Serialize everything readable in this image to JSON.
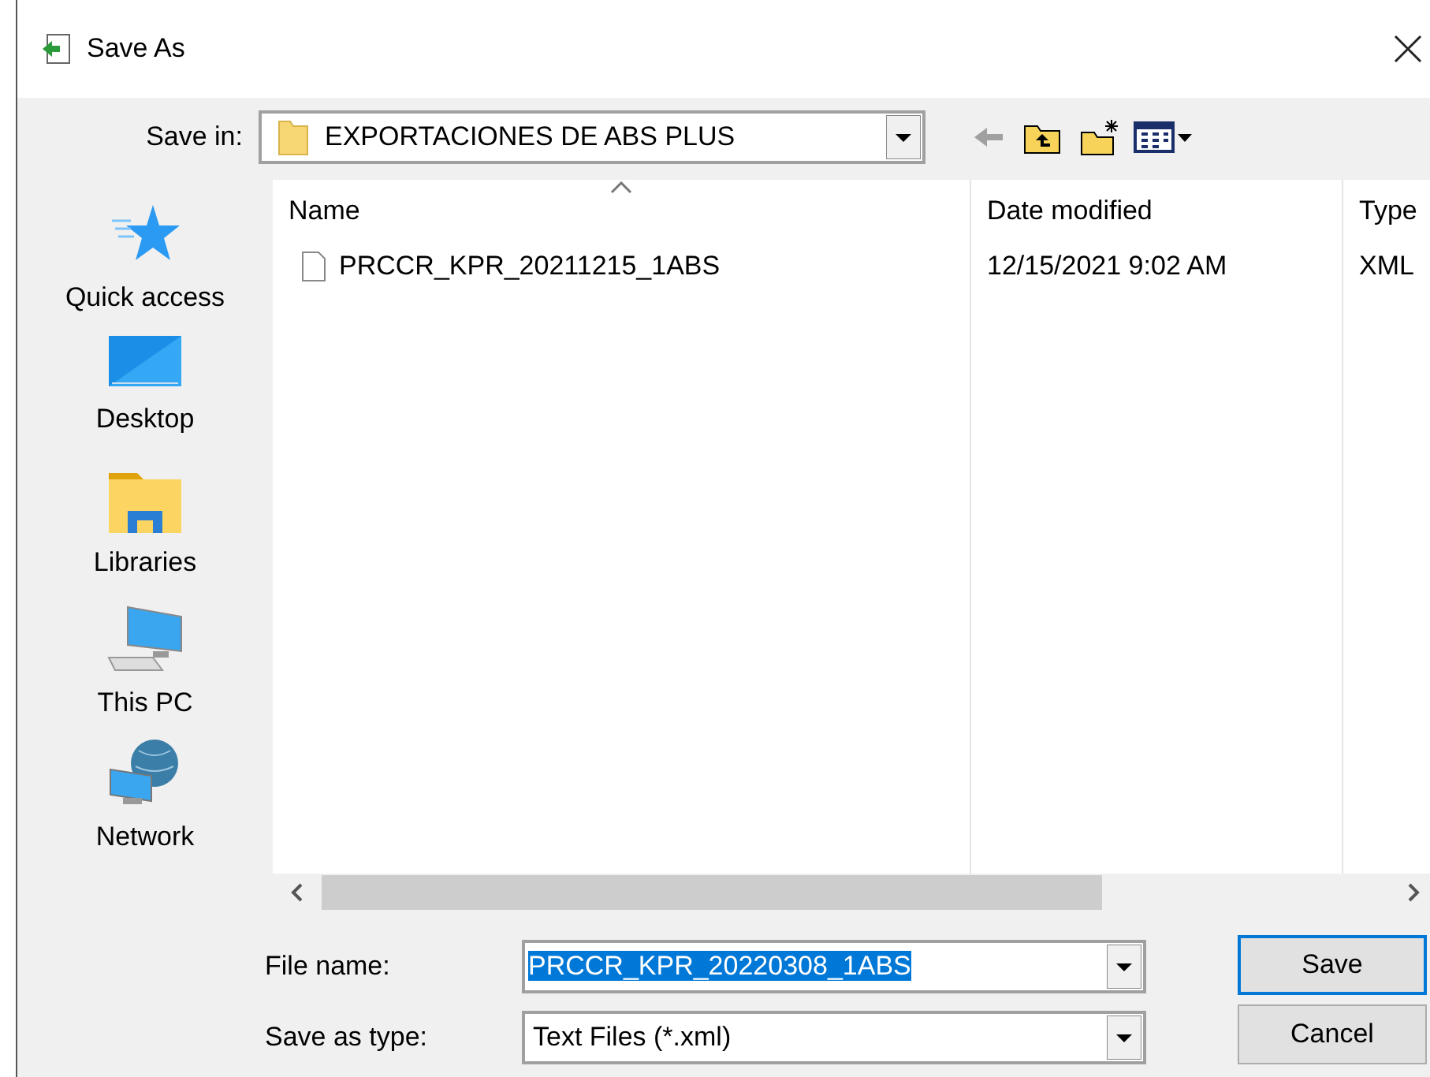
{
  "window": {
    "title": "Save As"
  },
  "save_in": {
    "label": "Save in:",
    "value": "EXPORTACIONES DE ABS PLUS"
  },
  "places": [
    {
      "label": "Quick access",
      "kind": "star"
    },
    {
      "label": "Desktop",
      "kind": "desktop"
    },
    {
      "label": "Libraries",
      "kind": "libraries"
    },
    {
      "label": "This PC",
      "kind": "pc"
    },
    {
      "label": "Network",
      "kind": "network"
    }
  ],
  "columns": [
    {
      "label": "Name",
      "sorted": true
    },
    {
      "label": "Date modified",
      "sorted": false
    },
    {
      "label": "Type",
      "sorted": false
    }
  ],
  "files": [
    {
      "name": "PRCCR_KPR_20211215_1ABS",
      "date": "12/15/2021 9:02 AM",
      "type": "XML"
    }
  ],
  "file_name": {
    "label": "File name:",
    "value": "PRCCR_KPR_20220308_1ABS",
    "selected": true
  },
  "save_as_type": {
    "label": "Save as type:",
    "value": "Text Files (*.xml)"
  },
  "buttons": [
    "Save",
    "Cancel"
  ]
}
